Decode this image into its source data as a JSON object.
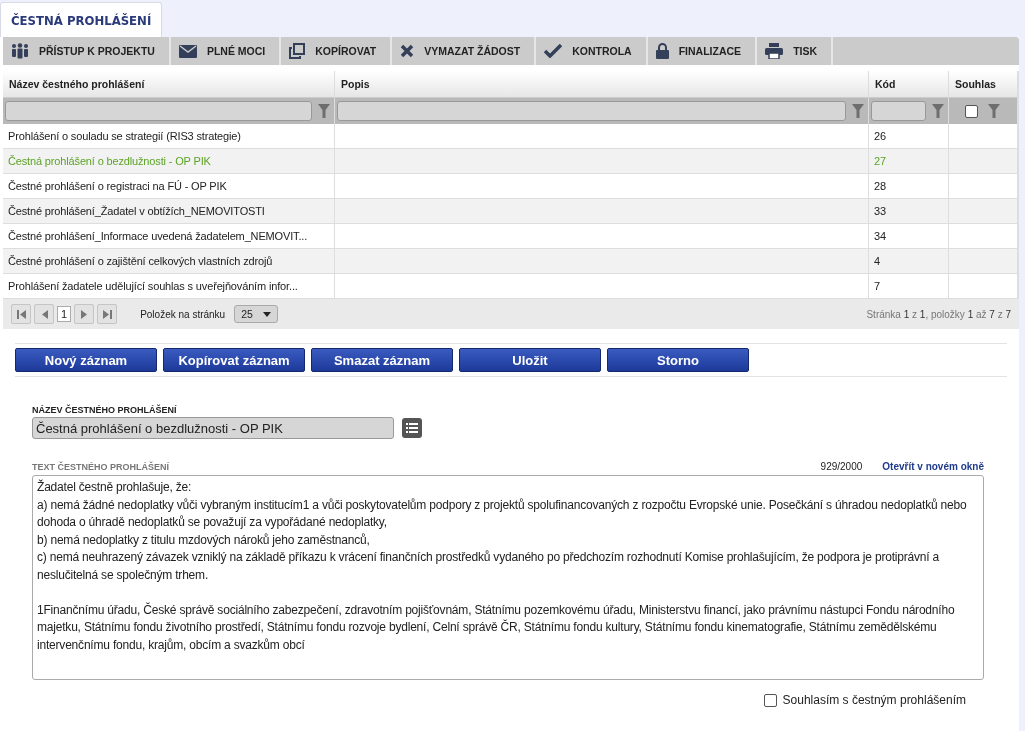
{
  "tab": {
    "label": "ČESTNÁ PROHLÁŠENÍ",
    "selected": true
  },
  "toolbar": [
    {
      "kind": "people",
      "label": "PŘÍSTUP K PROJEKTU"
    },
    {
      "kind": "envelope",
      "label": "PLNÉ MOCI"
    },
    {
      "kind": "copy",
      "label": "KOPÍROVAT"
    },
    {
      "kind": "cross",
      "label": "VYMAZAT ŽÁDOST"
    },
    {
      "kind": "check",
      "label": "KONTROLA"
    },
    {
      "kind": "lock",
      "label": "FINALIZACE"
    },
    {
      "kind": "printer",
      "label": "TISK"
    }
  ],
  "table": {
    "columns": [
      "Název čestného prohlášení",
      "Popis",
      "Kód",
      "Souhlas"
    ],
    "filter_checkbox": {
      "checked": false
    },
    "rows": [
      {
        "name": "Prohlášení o souladu se strategií (RIS3 strategie)",
        "code": "26",
        "selected": false
      },
      {
        "name": "Čestná prohlášení o bezdlužnosti - OP PIK",
        "code": "27",
        "selected": true
      },
      {
        "name": "Čestné prohlášení o registraci na FÚ - OP PIK",
        "code": "28",
        "selected": false
      },
      {
        "name": "Čestné prohlášení_Žadatel v obtížích_NEMOVITOSTI",
        "code": "33",
        "selected": false
      },
      {
        "name": "Čestné prohlášení_Informace uvedená žadatelem_NEMOVIT...",
        "code": "34",
        "selected": false
      },
      {
        "name": "Čestné prohlášení o zajištění celkových vlastních zdrojů",
        "code": "4",
        "selected": false
      },
      {
        "name": "Prohlášení žadatele udělující souhlas s uveřejňováním infor...",
        "code": "7",
        "selected": false
      }
    ]
  },
  "pager": {
    "page": "1",
    "per_page_label": "Položek na stránku",
    "per_page": "25",
    "summary": "Stránka **1** z **1**, položky **1** až **7** z **7**"
  },
  "buttons": [
    "Nový záznam",
    "Kopírovat záznam",
    "Smazat záznam",
    "Uložit",
    "Storno"
  ],
  "form": {
    "name_label": "NÁZEV ČESTNÉHO PROHLÁŠENÍ",
    "name_value": "Čestná prohlášení o bezdlužnosti - OP PIK",
    "text_label": "TEXT ČESTNÉHO PROHLÁŠENÍ",
    "counter": "929/2000",
    "open_link": "Otevřít v novém okně",
    "text": "Žadatel čestně prohlašuje, že:\na) nemá žádné nedoplatky vůči vybraným institucím1 a vůči poskytovatelům podpory z projektů spolufinancovaných z rozpočtu Evropské unie. Posečkání s úhradou nedoplatků nebo dohoda o úhradě nedoplatků se považují za vypořádané nedoplatky,\nb) nemá nedoplatky z titulu mzdových nároků jeho zaměstnanců,\nc) nemá neuhrazený závazek vzniklý na základě příkazu k vrácení finančních prostředků vydaného po předchozím rozhodnutí Komise prohlašujícím, že podpora je protiprávní a neslučitelná se společným trhem.\n\n1Finančnímu úřadu, České správě sociálního zabezpečení, zdravotním pojišťovnám, Státnímu pozemkovému úřadu, Ministerstvu financí, jako právnímu nástupci Fondu národního majetku, Státnímu fondu životního prostředí, Státnímu fondu rozvoje bydlení, Celní správě ČR, Státnímu fondu kultury, Státnímu fondu kinematografie, Státnímu zemědělskému intervenčnímu fondu, krajům, obcím a svazkům obcí",
    "agree": {
      "label": "Souhlasím s čestným prohlášením",
      "checked": false
    }
  }
}
